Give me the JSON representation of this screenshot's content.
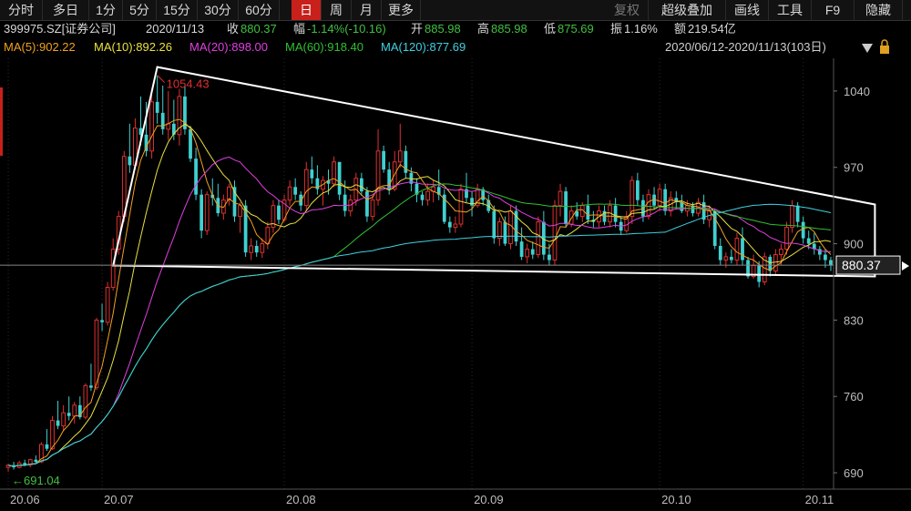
{
  "toolbar": {
    "items": [
      "分时",
      "多日",
      "1分",
      "5分",
      "15分",
      "30分",
      "60分",
      "日",
      "周",
      "月",
      "更多"
    ],
    "right_items": [
      "复权",
      "超级叠加",
      "画线",
      "工具",
      "F9",
      "隐藏"
    ],
    "active": "日"
  },
  "quote": {
    "code": "399975.SZ[证券公司]",
    "date": "2020/11/13",
    "close_label": "收",
    "close": "880.37",
    "change_label": "幅",
    "change": "-1.14%(-10.16)",
    "open_label": "开",
    "open": "885.98",
    "high_label": "高",
    "high": "885.98",
    "low_label": "低",
    "low": "875.69",
    "amplitude_label": "振",
    "amplitude": "1.16%",
    "amount_label": "额",
    "amount": "219.54亿"
  },
  "moving_averages": [
    {
      "label": "MA(5):902.22",
      "color": "#f0a020"
    },
    {
      "label": "MA(10):892.26",
      "color": "#e8e040"
    },
    {
      "label": "MA(20):898.00",
      "color": "#e040e0"
    },
    {
      "label": "MA(60):918.40",
      "color": "#30c030"
    },
    {
      "label": "MA(120):877.69",
      "color": "#40d0e0"
    }
  ],
  "date_range": "2020/06/12-2020/11/13(103日)",
  "colors": {
    "up": "#e03030",
    "down": "#40d0d0",
    "bg": "#000000",
    "grid": "#2a2a2a",
    "triangle": "#ffffff"
  },
  "chart_data": {
    "type": "candlestick",
    "ylim": [
      675,
      1070
    ],
    "y_ticks": [
      "1040",
      "970",
      "900",
      "830",
      "760",
      "690"
    ],
    "y_tick_values": [
      1040,
      970,
      900,
      830,
      760,
      690
    ],
    "x_tick_labels": [
      "20.06",
      "20.07",
      "20.08",
      "20.09",
      "20.10",
      "20.11"
    ],
    "x_tick_indices": [
      0,
      17,
      50,
      84,
      118,
      144
    ],
    "last_price_label": "880.37",
    "last_price": 880.37,
    "high_annotation": "1054.43",
    "high_value": 1054.43,
    "high_index": 27,
    "low_annotation": "691.04",
    "low_value": 691.04,
    "low_index": 0,
    "triangle": [
      [
        19,
        880
      ],
      [
        27,
        1062
      ],
      [
        157,
        936
      ],
      [
        157,
        870
      ]
    ],
    "candles": [
      [
        695,
        698,
        691,
        697
      ],
      [
        697,
        700,
        693,
        695
      ],
      [
        695,
        701,
        694,
        699
      ],
      [
        699,
        702,
        696,
        697
      ],
      [
        697,
        703,
        695,
        702
      ],
      [
        702,
        706,
        699,
        700
      ],
      [
        700,
        718,
        699,
        716
      ],
      [
        716,
        730,
        710,
        712
      ],
      [
        712,
        742,
        711,
        738
      ],
      [
        738,
        756,
        730,
        733
      ],
      [
        733,
        752,
        728,
        745
      ],
      [
        745,
        760,
        738,
        742
      ],
      [
        742,
        755,
        735,
        752
      ],
      [
        752,
        760,
        739,
        741
      ],
      [
        741,
        772,
        739,
        770
      ],
      [
        770,
        790,
        765,
        768
      ],
      [
        768,
        832,
        766,
        830
      ],
      [
        830,
        845,
        820,
        828
      ],
      [
        828,
        865,
        825,
        860
      ],
      [
        860,
        905,
        857,
        895
      ],
      [
        895,
        930,
        890,
        925
      ],
      [
        925,
        985,
        920,
        980
      ],
      [
        980,
        1010,
        965,
        972
      ],
      [
        972,
        1015,
        968,
        1006
      ],
      [
        1006,
        1035,
        990,
        1000
      ],
      [
        1000,
        1030,
        980,
        985
      ],
      [
        985,
        1040,
        978,
        1030
      ],
      [
        1030,
        1054,
        1010,
        1020
      ],
      [
        1020,
        1045,
        1000,
        1005
      ],
      [
        1005,
        1040,
        995,
        1010
      ],
      [
        1010,
        1032,
        995,
        1000
      ],
      [
        1000,
        1042,
        990,
        1035
      ],
      [
        1035,
        1045,
        1000,
        1005
      ],
      [
        1005,
        1008,
        975,
        978
      ],
      [
        978,
        988,
        940,
        945
      ],
      [
        945,
        950,
        905,
        912
      ],
      [
        912,
        948,
        908,
        945
      ],
      [
        945,
        960,
        935,
        942
      ],
      [
        942,
        955,
        925,
        928
      ],
      [
        928,
        945,
        922,
        940
      ],
      [
        940,
        955,
        935,
        952
      ],
      [
        952,
        958,
        920,
        925
      ],
      [
        925,
        938,
        910,
        935
      ],
      [
        935,
        940,
        888,
        892
      ],
      [
        892,
        905,
        885,
        898
      ],
      [
        898,
        903,
        888,
        892
      ],
      [
        892,
        905,
        887,
        900
      ],
      [
        900,
        920,
        895,
        915
      ],
      [
        915,
        940,
        910,
        935
      ],
      [
        935,
        940,
        918,
        922
      ],
      [
        922,
        945,
        920,
        940
      ],
      [
        940,
        958,
        935,
        952
      ],
      [
        952,
        960,
        940,
        945
      ],
      [
        945,
        948,
        930,
        935
      ],
      [
        935,
        975,
        930,
        968
      ],
      [
        968,
        980,
        955,
        960
      ],
      [
        960,
        972,
        945,
        950
      ],
      [
        950,
        962,
        935,
        958
      ],
      [
        958,
        968,
        945,
        955
      ],
      [
        955,
        980,
        952,
        975
      ],
      [
        975,
        972,
        940,
        945
      ],
      [
        945,
        958,
        925,
        930
      ],
      [
        930,
        945,
        925,
        940
      ],
      [
        940,
        965,
        935,
        960
      ],
      [
        960,
        965,
        945,
        948
      ],
      [
        948,
        952,
        920,
        925
      ],
      [
        925,
        944,
        921,
        940
      ],
      [
        940,
        1005,
        935,
        985
      ],
      [
        985,
        990,
        965,
        968
      ],
      [
        968,
        975,
        945,
        950
      ],
      [
        950,
        985,
        948,
        975
      ],
      [
        975,
        1010,
        970,
        985
      ],
      [
        985,
        990,
        960,
        965
      ],
      [
        965,
        970,
        948,
        955
      ],
      [
        955,
        960,
        938,
        945
      ],
      [
        945,
        948,
        935,
        940
      ],
      [
        940,
        955,
        935,
        948
      ],
      [
        948,
        958,
        938,
        952
      ],
      [
        952,
        968,
        940,
        945
      ],
      [
        945,
        950,
        918,
        920
      ],
      [
        920,
        925,
        910,
        915
      ],
      [
        915,
        925,
        910,
        918
      ],
      [
        918,
        955,
        915,
        950
      ],
      [
        950,
        965,
        938,
        942
      ],
      [
        942,
        948,
        925,
        935
      ],
      [
        935,
        955,
        933,
        950
      ],
      [
        950,
        952,
        935,
        940
      ],
      [
        940,
        945,
        928,
        930
      ],
      [
        930,
        935,
        900,
        905
      ],
      [
        905,
        924,
        898,
        920
      ],
      [
        920,
        925,
        898,
        900
      ],
      [
        900,
        935,
        895,
        930
      ],
      [
        930,
        935,
        898,
        902
      ],
      [
        902,
        915,
        885,
        888
      ],
      [
        888,
        900,
        882,
        895
      ],
      [
        895,
        902,
        886,
        890
      ],
      [
        890,
        925,
        887,
        920
      ],
      [
        920,
        930,
        885,
        890
      ],
      [
        890,
        900,
        880,
        885
      ],
      [
        885,
        940,
        880,
        935
      ],
      [
        935,
        955,
        925,
        948
      ],
      [
        948,
        952,
        915,
        918
      ],
      [
        918,
        935,
        915,
        930
      ],
      [
        930,
        938,
        922,
        925
      ],
      [
        925,
        938,
        920,
        935
      ],
      [
        935,
        945,
        918,
        922
      ],
      [
        922,
        930,
        915,
        920
      ],
      [
        920,
        935,
        915,
        930
      ],
      [
        930,
        935,
        917,
        920
      ],
      [
        920,
        940,
        915,
        935
      ],
      [
        935,
        942,
        915,
        920
      ],
      [
        920,
        925,
        908,
        912
      ],
      [
        912,
        930,
        910,
        925
      ],
      [
        925,
        962,
        918,
        958
      ],
      [
        958,
        965,
        935,
        940
      ],
      [
        940,
        945,
        920,
        925
      ],
      [
        925,
        950,
        922,
        945
      ],
      [
        945,
        952,
        932,
        935
      ],
      [
        935,
        955,
        930,
        950
      ],
      [
        950,
        955,
        926,
        930
      ],
      [
        930,
        948,
        925,
        942
      ],
      [
        942,
        948,
        932,
        938
      ],
      [
        938,
        945,
        928,
        930
      ],
      [
        930,
        940,
        925,
        935
      ],
      [
        935,
        938,
        925,
        928
      ],
      [
        928,
        942,
        925,
        938
      ],
      [
        938,
        945,
        918,
        922
      ],
      [
        922,
        935,
        915,
        930
      ],
      [
        930,
        932,
        895,
        898
      ],
      [
        898,
        905,
        880,
        885
      ],
      [
        885,
        892,
        878,
        888
      ],
      [
        888,
        895,
        882,
        885
      ],
      [
        885,
        910,
        880,
        905
      ],
      [
        905,
        915,
        880,
        885
      ],
      [
        885,
        888,
        868,
        870
      ],
      [
        870,
        890,
        868,
        880
      ],
      [
        880,
        884,
        860,
        865
      ],
      [
        865,
        892,
        862,
        888
      ],
      [
        888,
        890,
        870,
        875
      ],
      [
        875,
        895,
        872,
        890
      ],
      [
        890,
        900,
        880,
        895
      ],
      [
        895,
        920,
        890,
        915
      ],
      [
        915,
        940,
        910,
        935
      ],
      [
        935,
        938,
        915,
        920
      ],
      [
        920,
        925,
        900,
        905
      ],
      [
        905,
        912,
        895,
        900
      ],
      [
        900,
        910,
        890,
        895
      ],
      [
        895,
        898,
        885,
        890
      ],
      [
        890,
        895,
        878,
        885
      ],
      [
        885,
        888,
        875,
        880
      ]
    ]
  }
}
